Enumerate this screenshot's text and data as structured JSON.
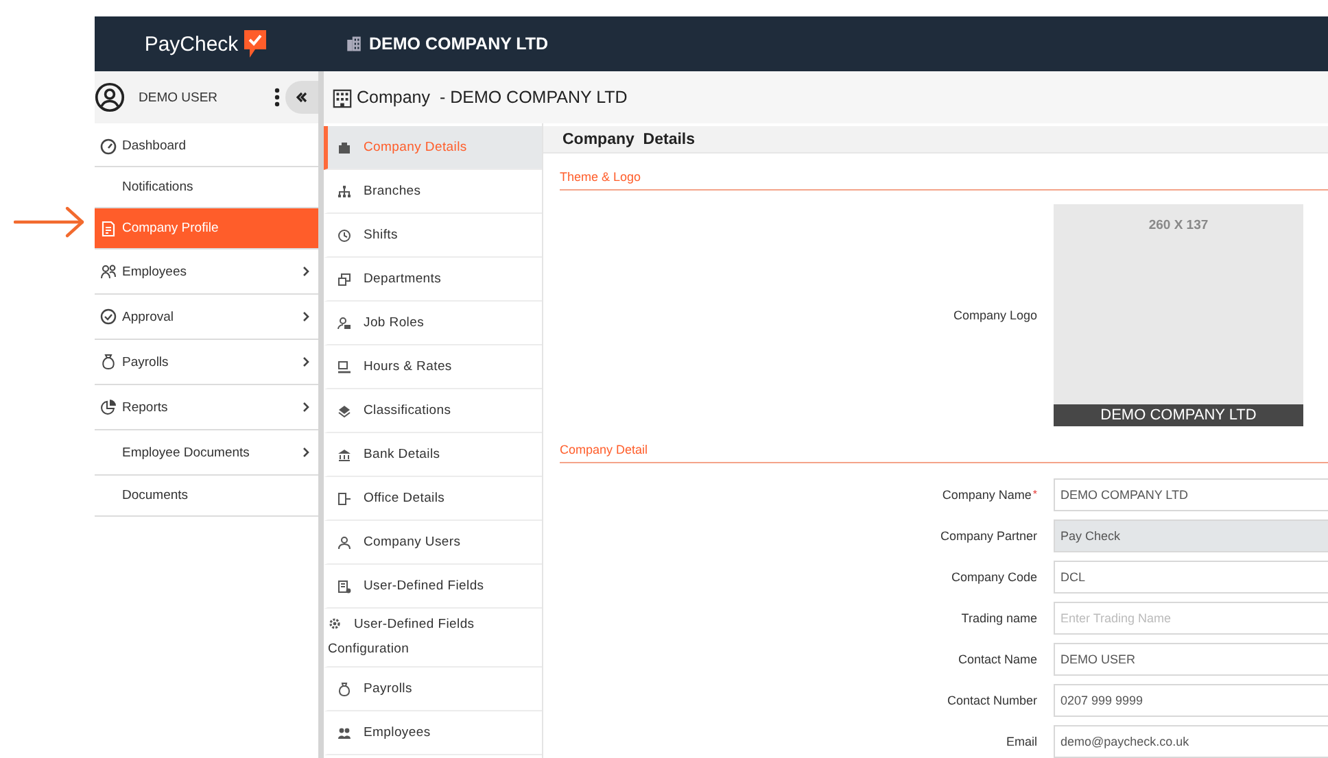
{
  "topbar": {
    "brand": "PayCheck",
    "company": "DEMO COMPANY LTD"
  },
  "user": {
    "name": "DEMO USER"
  },
  "sidebar": {
    "items": [
      {
        "label": "Dashboard",
        "selected": false,
        "expandable": false
      },
      {
        "label": "Notifications",
        "selected": false,
        "expandable": false
      },
      {
        "label": "Company Profile",
        "selected": true,
        "expandable": false
      },
      {
        "label": "Employees",
        "selected": false,
        "expandable": true
      },
      {
        "label": "Approval",
        "selected": false,
        "expandable": true
      },
      {
        "label": "Payrolls",
        "selected": false,
        "expandable": true
      },
      {
        "label": "Reports",
        "selected": false,
        "expandable": true
      },
      {
        "label": "Employee Documents",
        "selected": false,
        "expandable": true
      },
      {
        "label": "Documents",
        "selected": false,
        "expandable": false
      }
    ]
  },
  "page_title": "Company  - DEMO COMPANY LTD",
  "subnav": {
    "items": [
      {
        "label": "Company Details",
        "selected": true
      },
      {
        "label": "Branches",
        "selected": false
      },
      {
        "label": "Shifts",
        "selected": false
      },
      {
        "label": "Departments",
        "selected": false
      },
      {
        "label": "Job Roles",
        "selected": false
      },
      {
        "label": "Hours & Rates",
        "selected": false
      },
      {
        "label": "Classifications",
        "selected": false
      },
      {
        "label": "Bank Details",
        "selected": false
      },
      {
        "label": "Office Details",
        "selected": false
      },
      {
        "label": "Company Users",
        "selected": false
      },
      {
        "label": "User-Defined Fields",
        "selected": false
      },
      {
        "label": "User-Defined Fields Configuration",
        "selected": false
      },
      {
        "label": "Payrolls",
        "selected": false
      },
      {
        "label": "Employees",
        "selected": false
      }
    ]
  },
  "panel": {
    "title": "Company  Details",
    "sections": [
      {
        "title": "Theme & Logo",
        "logo": {
          "label": "Company Logo",
          "size_hint": "260 X 137",
          "caption": "DEMO COMPANY LTD"
        }
      },
      {
        "title": "Company Detail",
        "fields": [
          {
            "label": "Company Name",
            "required_mark": "*",
            "value": "DEMO COMPANY LTD",
            "disabled": false
          },
          {
            "label": "Company Partner",
            "value": "Pay Check",
            "disabled": true
          },
          {
            "label": "Company Code",
            "value": "DCL",
            "disabled": false
          },
          {
            "label": "Trading name",
            "placeholder": "Enter Trading Name",
            "disabled": false
          },
          {
            "label": "Contact Name",
            "value": "DEMO USER",
            "disabled": false
          },
          {
            "label": "Contact Number",
            "value": "0207 999 9999",
            "disabled": false
          },
          {
            "label": "Email",
            "value": "demo@paycheck.co.uk",
            "disabled": false
          }
        ]
      }
    ]
  }
}
